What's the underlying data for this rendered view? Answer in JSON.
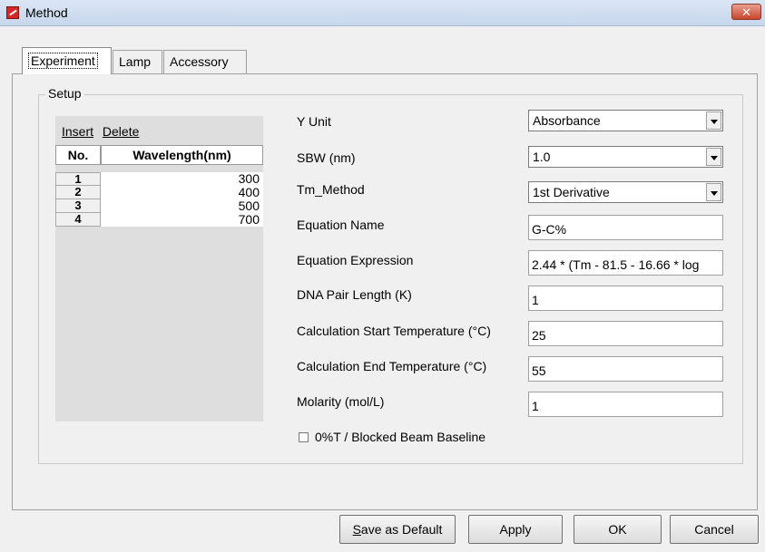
{
  "window": {
    "title": "Method",
    "close_label": "✕"
  },
  "tabs": [
    {
      "label": "Experiment",
      "active": true
    },
    {
      "label": "Lamp"
    },
    {
      "label": "Accessory"
    }
  ],
  "setup": {
    "legend": "Setup",
    "grid": {
      "insert_label": "Insert",
      "delete_label": "Delete",
      "col_no": "No.",
      "col_wavelength": "Wavelength(nm)",
      "rows": [
        {
          "no": "1",
          "value": "300"
        },
        {
          "no": "2",
          "value": "400"
        },
        {
          "no": "3",
          "value": "500"
        },
        {
          "no": "4",
          "value": "700"
        }
      ]
    },
    "fields": {
      "y_unit": {
        "label": "Y Unit",
        "value": "Absorbance"
      },
      "sbw": {
        "label": "SBW (nm)",
        "value": "1.0"
      },
      "tm_method": {
        "label": "Tm_Method",
        "value": "1st Derivative"
      },
      "equation_name": {
        "label": "Equation Name",
        "value": "G-C%"
      },
      "equation_expression": {
        "label": "Equation Expression",
        "value": "2.44 * (Tm - 81.5 - 16.66 * log"
      },
      "dna_pair_length": {
        "label": "DNA Pair Length (K)",
        "value": "1"
      },
      "calc_start_temp": {
        "label": "Calculation Start Temperature (°C)",
        "value": "25"
      },
      "calc_end_temp": {
        "label": "Calculation End Temperature (°C)",
        "value": "55"
      },
      "molarity": {
        "label": "Molarity (mol/L)",
        "value": "1"
      }
    },
    "baseline_checkbox": {
      "label": "0%T / Blocked Beam Baseline",
      "checked": false
    }
  },
  "buttons": {
    "save_default_first": "S",
    "save_default_rest": "ave as Default",
    "apply": "Apply",
    "ok": "OK",
    "cancel": "Cancel"
  }
}
